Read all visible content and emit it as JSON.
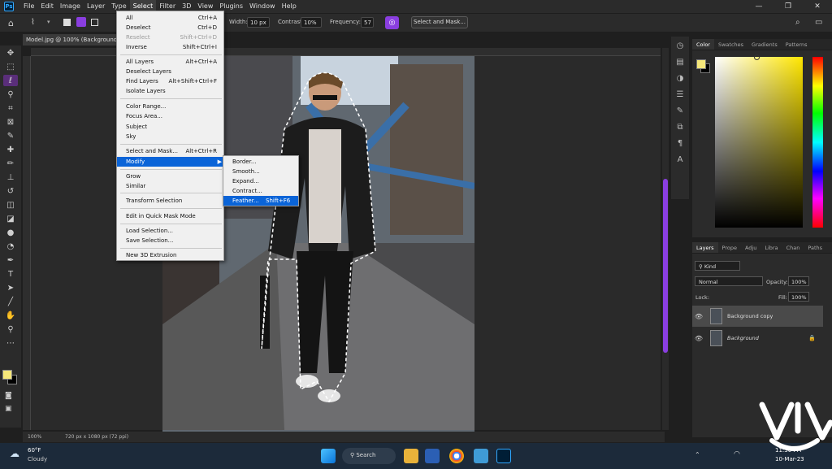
{
  "app": {
    "logo": "Ps"
  },
  "menubar": {
    "items": [
      "File",
      "Edit",
      "Image",
      "Layer",
      "Type",
      "Select",
      "Filter",
      "3D",
      "View",
      "Plugins",
      "Window",
      "Help"
    ],
    "active": "Select"
  },
  "window_controls": {
    "minimize": "—",
    "restore": "❐",
    "close": "✕"
  },
  "options_bar": {
    "width_label": "Width:",
    "width_value": "10 px",
    "contrast_label": "Contrast:",
    "contrast_value": "10%",
    "frequency_label": "Frequency:",
    "frequency_value": "57",
    "select_mask_button": "Select and Mask..."
  },
  "document": {
    "tab_title": "Model.jpg @ 100% (Background",
    "status": "100%",
    "doc_info": "720 px x 1080 px (72 ppi)"
  },
  "select_menu": {
    "items": [
      {
        "label": "All",
        "shortcut": "Ctrl+A"
      },
      {
        "label": "Deselect",
        "shortcut": "Ctrl+D"
      },
      {
        "label": "Reselect",
        "shortcut": "Shift+Ctrl+D",
        "disabled": true
      },
      {
        "label": "Inverse",
        "shortcut": "Shift+Ctrl+I"
      },
      {
        "label": "All Layers",
        "shortcut": "Alt+Ctrl+A"
      },
      {
        "label": "Deselect Layers",
        "shortcut": ""
      },
      {
        "label": "Find Layers",
        "shortcut": "Alt+Shift+Ctrl+F"
      },
      {
        "label": "Isolate Layers",
        "shortcut": ""
      },
      {
        "label": "Color Range...",
        "shortcut": ""
      },
      {
        "label": "Focus Area...",
        "shortcut": ""
      },
      {
        "label": "Subject",
        "shortcut": ""
      },
      {
        "label": "Sky",
        "shortcut": ""
      },
      {
        "label": "Select and Mask...",
        "shortcut": "Alt+Ctrl+R"
      },
      {
        "label": "Modify",
        "shortcut": ""
      },
      {
        "label": "Grow",
        "shortcut": ""
      },
      {
        "label": "Similar",
        "shortcut": ""
      },
      {
        "label": "Transform Selection",
        "shortcut": ""
      },
      {
        "label": "Edit in Quick Mask Mode",
        "shortcut": ""
      },
      {
        "label": "Load Selection...",
        "shortcut": ""
      },
      {
        "label": "Save Selection...",
        "shortcut": ""
      },
      {
        "label": "New 3D Extrusion",
        "shortcut": ""
      }
    ]
  },
  "modify_submenu": {
    "items": [
      {
        "label": "Border...",
        "shortcut": ""
      },
      {
        "label": "Smooth...",
        "shortcut": ""
      },
      {
        "label": "Expand...",
        "shortcut": ""
      },
      {
        "label": "Contract...",
        "shortcut": ""
      },
      {
        "label": "Feather...",
        "shortcut": "Shift+F6"
      }
    ]
  },
  "color_panel": {
    "tabs": [
      "Color",
      "Swatches",
      "Gradients",
      "Patterns"
    ],
    "foreground": "#f5e77a",
    "background": "#000000"
  },
  "layers_panel": {
    "tabs": [
      "Layers",
      "Prope",
      "Adju",
      "Libra",
      "Chan",
      "Paths"
    ],
    "kind_filter": "Kind",
    "blend_mode": "Normal",
    "opacity_label": "Opacity:",
    "opacity_value": "100%",
    "lock_label": "Lock:",
    "fill_label": "Fill:",
    "fill_value": "100%",
    "layers": [
      {
        "name": "Background copy",
        "selected": true
      },
      {
        "name": "Background",
        "selected": false
      }
    ]
  },
  "taskbar": {
    "weather_temp": "60°F",
    "weather_desc": "Cloudy",
    "search_label": "Search",
    "time": "11:30 PM",
    "date": "10-Mar-23"
  },
  "colors": {
    "accent": "#8a3ee0",
    "highlight": "#0a64d8",
    "menu_bg": "#f0f0f0"
  }
}
